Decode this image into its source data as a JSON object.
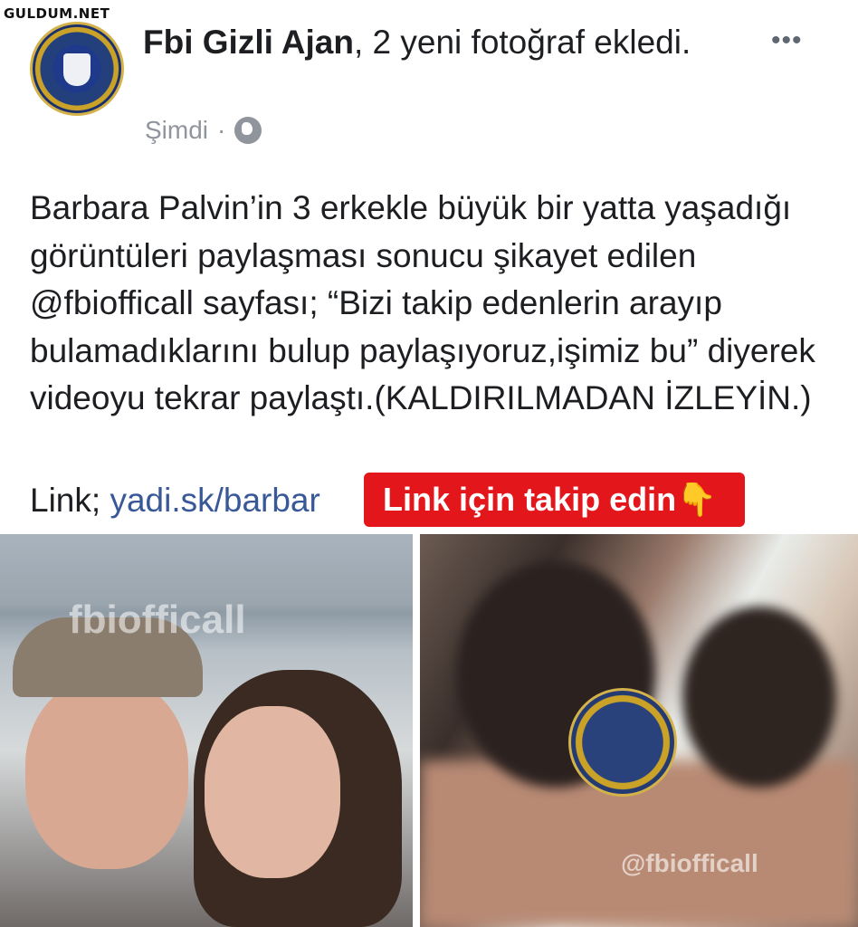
{
  "site_watermark": "GULDUM.NET",
  "post": {
    "author": "Fbi Gizli Ajan",
    "action": ", 2 yeni fotoğraf ekledi.",
    "time": "Şimdi",
    "separator": "·",
    "privacy_icon": "globe-icon",
    "more_icon": "more-options-icon",
    "more_label": "•••",
    "body_text": "Barbara Palvin’in 3 erkekle büyük bir yatta yaşadığı görüntüleri paylaşması sonucu şikayet edilen @fbiofficall sayfası; “Bizi takip edenlerin arayıp bulamadıklarını bulup paylaşıyoruz,işimiz bu” diyerek videoyu tekrar paylaştı.(KALDIRILMADAN İZLEYİN.)",
    "link_prefix": "Link; ",
    "link_text": "yadi.sk/barbar"
  },
  "overlay_badge": {
    "text": "Link için takip edin👇",
    "color": "#e3161b"
  },
  "photos": {
    "left_watermark": "fbiofficall",
    "right_watermark": "@fbiofficall"
  },
  "colors": {
    "link": "#385898",
    "meta": "#90949c",
    "text": "#1c1e21"
  }
}
